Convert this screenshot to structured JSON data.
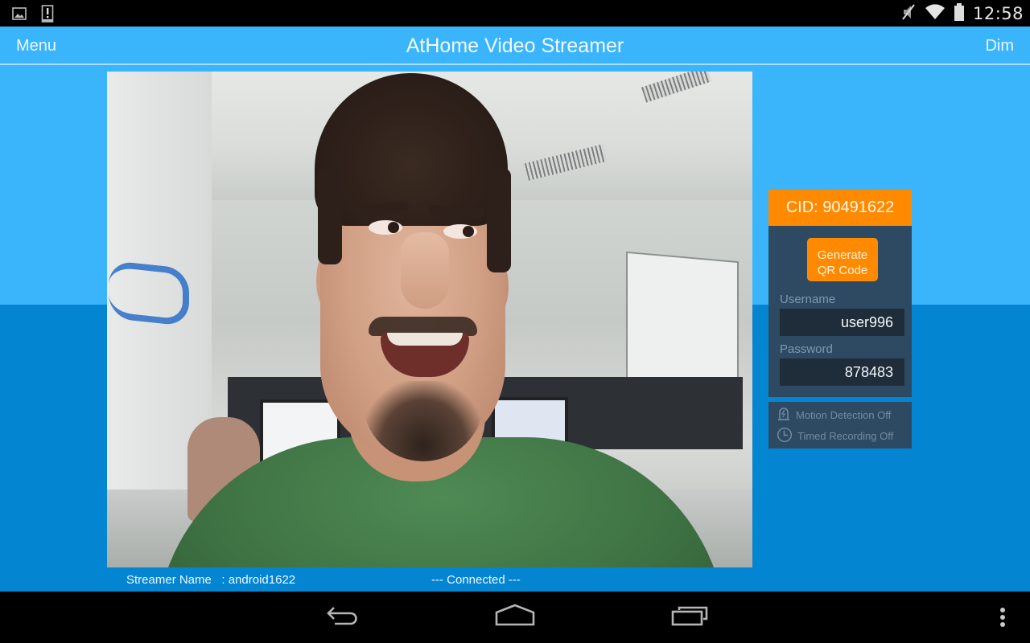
{
  "status_bar": {
    "left_icons": [
      "gallery-notification-icon",
      "alert-notification-icon"
    ],
    "right_icons": [
      "muted-icon",
      "wifi-icon",
      "battery-icon"
    ],
    "time": "12:58"
  },
  "action_bar": {
    "menu_label": "Menu",
    "title": "AtHome Video Streamer",
    "dim_label": "Dim"
  },
  "video": {
    "description": "Live camera preview"
  },
  "footer": {
    "streamer_name_label": "Streamer Name",
    "streamer_name_separator": ":",
    "streamer_name_value": "android1622",
    "connection_status": "--- Connected ---"
  },
  "cid_panel": {
    "cid_label": "CID: 90491622",
    "qr_button_line1": "Generate",
    "qr_button_line2": "QR Code",
    "username_label": "Username",
    "username_value": "user996",
    "password_label": "Password",
    "password_value": "878483"
  },
  "status_panel": {
    "motion_detection": "Motion Detection Off",
    "timed_recording": "Timed Recording Off"
  },
  "nav_bar": {
    "buttons": [
      "back-icon",
      "home-icon",
      "recent-apps-icon",
      "overflow-menu-icon"
    ]
  },
  "colors": {
    "accent_orange": "#ff8a00",
    "action_bar_blue": "#3ab5fc",
    "lower_blue": "#0385d1",
    "panel_navy": "#2e4a62",
    "field_dark": "#1f2d3b"
  }
}
